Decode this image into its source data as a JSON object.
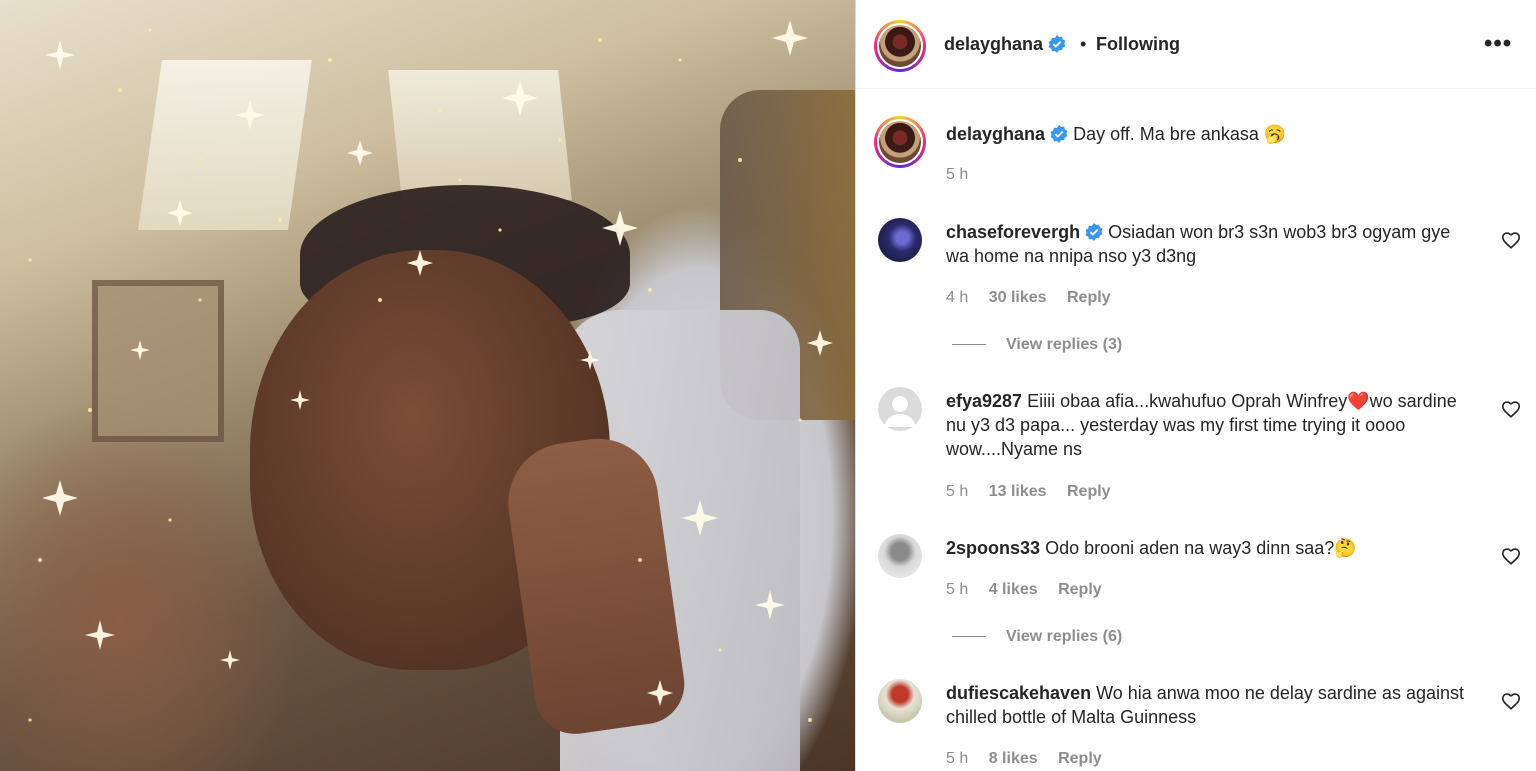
{
  "post": {
    "username": "delayghana",
    "follow_status": "Following",
    "dot": "•",
    "more_icon": "•••",
    "caption": "Day off. Ma bre ankasa 🥱",
    "caption_time": "5 h"
  },
  "comments": [
    {
      "username": "chaseforevergh",
      "verified": true,
      "text": "Osiadan won br3 s3n wob3 br3 ogyam gye wa home na nnipa nso y3 d3ng",
      "time": "4 h",
      "likes": "30 likes",
      "reply": "Reply",
      "view_replies": "View replies (3)"
    },
    {
      "username": "efya9287",
      "verified": false,
      "text": "Eiiii obaa afia...kwahufuo Oprah Winfrey❤️wo sardine nu y3 d3 papa... yesterday was my first time trying it oooo wow....Nyame ns",
      "time": "5 h",
      "likes": "13 likes",
      "reply": "Reply"
    },
    {
      "username": "2spoons33",
      "verified": false,
      "text": "Odo brooni aden na way3 dinn saa?🤔",
      "time": "5 h",
      "likes": "4 likes",
      "reply": "Reply",
      "view_replies": "View replies (6)"
    },
    {
      "username": "dufiescakehaven",
      "verified": false,
      "text": "Wo hia anwa moo ne delay sardine as against chilled bottle of Malta Guinness",
      "time": "5 h",
      "likes": "8 likes",
      "reply": "Reply"
    }
  ],
  "colors": {
    "text": "#262626",
    "muted": "#8e8e8e",
    "verified": "#3897f0",
    "border": "#dbdbdb"
  }
}
